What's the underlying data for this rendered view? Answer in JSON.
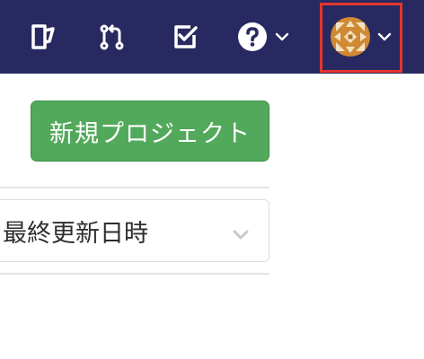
{
  "navbar": {
    "background": "#292961",
    "icons": [
      "snippets-icon",
      "merge-request-icon",
      "todo-icon",
      "help-icon",
      "user-avatar"
    ],
    "icon_color": "#ffffff"
  },
  "toolbar": {
    "new_project_label": "新規プロジェクト",
    "button_color": "#52a95b"
  },
  "sort": {
    "selected": "最終更新日時"
  },
  "highlight_color": "#e2362e"
}
